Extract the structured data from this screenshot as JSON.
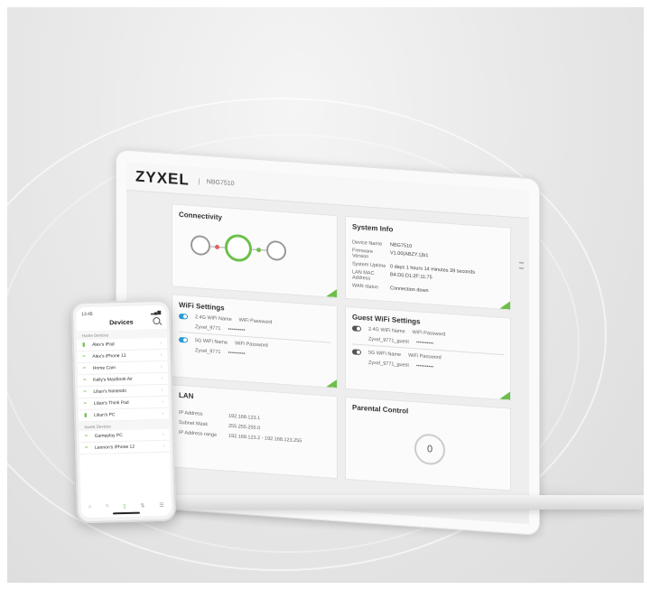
{
  "laptop": {
    "brand": "ZYXEL",
    "model": "NBG7510",
    "cards": {
      "connectivity": {
        "title": "Connectivity"
      },
      "system_info": {
        "title": "System Info",
        "rows": [
          {
            "key": "Device Name",
            "value": "NBG7510"
          },
          {
            "key": "Firmware Version",
            "value": "V1.00(ABZY.1)b1"
          },
          {
            "key": "System Uptime",
            "value": "0 days 1 hours 14 minutes 39 seconds"
          },
          {
            "key": "LAN MAC Address",
            "value": "B4:D5:D1:2F:11:75"
          },
          {
            "key": "WAN status",
            "value": "Connection down"
          }
        ]
      },
      "wifi": {
        "title": "WiFi Settings",
        "band_label": "2.4G WiFi Name",
        "pw_label": "WiFi Password",
        "ssid": "Zyxel_9771",
        "pw": "••••••••••",
        "band2_label": "5G WiFi Name",
        "ssid2": "Zyxel_9771",
        "pw2": "••••••••••"
      },
      "guest": {
        "title": "Guest WiFi Settings",
        "band_label": "2.4G WiFi Name",
        "pw_label": "WiFi Password",
        "ssid": "Zyxel_9771_guest",
        "pw": "••••••••••",
        "band2_label": "5G WiFi Name",
        "ssid2": "Zyxel_9771_guest",
        "pw2": "••••••••••"
      },
      "lan": {
        "title": "LAN",
        "rows": [
          {
            "key": "IP Address",
            "value": "192.168.123.1"
          },
          {
            "key": "Subnet Mask",
            "value": "255.255.255.0"
          },
          {
            "key": "IP Address range",
            "value": "192.168.123.2 - 192.168.123.255"
          }
        ]
      },
      "parental": {
        "title": "Parental Control",
        "count": "0"
      }
    }
  },
  "phone": {
    "time": "13:45",
    "title": "Devices",
    "sections": [
      {
        "label": "Home Devices",
        "items": [
          "Alex's iPad",
          "Alex's iPhone 13",
          "Home Cam",
          "Kelly's MacBook Air",
          "Lilian's Nintendo",
          "Lilian's Think Pad",
          "Lilian's PC"
        ]
      },
      {
        "label": "Guest Devices",
        "items": [
          "Gameplay PC",
          "Lennon's iPhone 12"
        ]
      }
    ]
  },
  "colors": {
    "accent": "#6cc04a",
    "toggle": "#2e9bd6"
  }
}
